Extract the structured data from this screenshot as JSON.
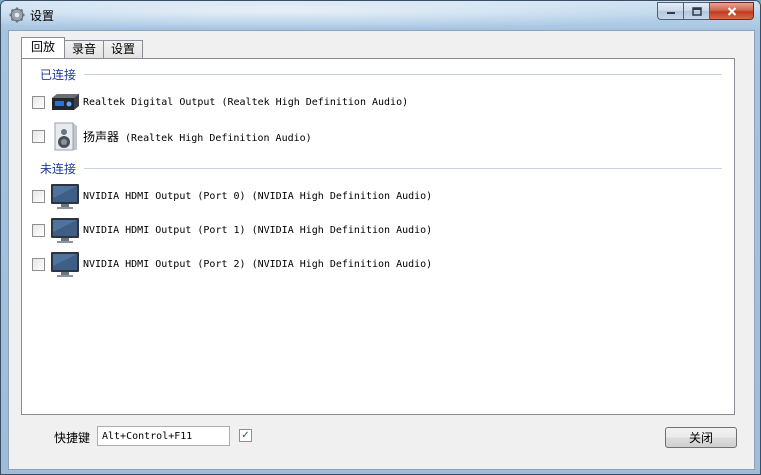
{
  "window": {
    "title": "设置"
  },
  "tabs": [
    {
      "label": "回放",
      "active": true
    },
    {
      "label": "录音",
      "active": false
    },
    {
      "label": "设置",
      "active": false
    }
  ],
  "groups": {
    "connected": {
      "label": "已连接",
      "devices": [
        {
          "label": "Realtek Digital Output (Realtek High Definition Audio)",
          "icon": "digital-output-icon",
          "checked": false
        },
        {
          "label": "扬声器",
          "label_suffix": " (Realtek High Definition Audio)",
          "icon": "speaker-icon",
          "checked": false
        }
      ]
    },
    "disconnected": {
      "label": "未连接",
      "devices": [
        {
          "label": "NVIDIA HDMI Output (Port 0) (NVIDIA High Definition Audio)",
          "icon": "monitor-icon",
          "checked": false
        },
        {
          "label": "NVIDIA HDMI Output (Port 1) (NVIDIA High Definition Audio)",
          "icon": "monitor-icon",
          "checked": false
        },
        {
          "label": "NVIDIA HDMI Output (Port 2) (NVIDIA High Definition Audio)",
          "icon": "monitor-icon",
          "checked": false
        }
      ]
    }
  },
  "footer": {
    "hotkey_label": "快捷键",
    "hotkey_value": "Alt+Control+F11",
    "hotkey_enabled": true,
    "close_label": "关闭"
  }
}
